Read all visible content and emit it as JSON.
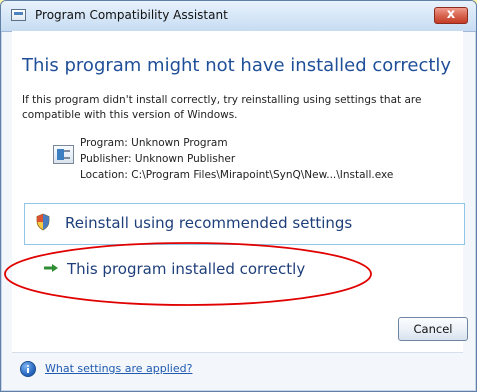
{
  "window": {
    "title": "Program Compatibility Assistant",
    "close_label": "x"
  },
  "content": {
    "heading": "This program might not have installed correctly",
    "description": "If this program didn't install correctly, try reinstalling using settings that are compatible with this version of Windows.",
    "program_line": "Program: Unknown Program",
    "publisher_line": "Publisher: Unknown Publisher",
    "location_line": "Location: C:\\Program Files\\Mirapoint\\SynQ\\New...\\Install.exe"
  },
  "options": {
    "reinstall": "Reinstall using recommended settings",
    "installed_correctly": "This program installed correctly"
  },
  "buttons": {
    "cancel": "Cancel"
  },
  "footer": {
    "link": "What settings are applied?"
  },
  "colors": {
    "background": "#fdf7a8",
    "heading": "#1f4f98",
    "link": "#1f5bb0",
    "highlight": "#e10000"
  },
  "icons": {
    "title": "app-icon",
    "program": "program-window-icon",
    "reinstall": "shield-icon",
    "installed": "arrow-icon",
    "info": "info-icon"
  }
}
